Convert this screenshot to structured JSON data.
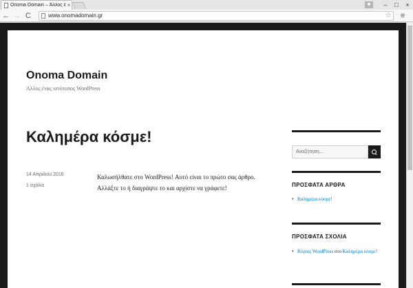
{
  "browser": {
    "tab_title": "Onoma Domain – Άλλος ένας ιστότοπος WordPress",
    "tab_close": "×",
    "url": "www.onomadomain.gr",
    "window_controls": {
      "minimize": "–",
      "maximize": "□",
      "close": "×"
    },
    "nav": {
      "back": "←",
      "forward": "→",
      "reload": "C"
    },
    "star": "☆",
    "menu": "≡"
  },
  "site": {
    "title": "Onoma Domain",
    "description": "Άλλος ένας ιστότοπος WordPress"
  },
  "post": {
    "title": "Καλημέρα κόσμε!",
    "date": "14 Απριλίου 2016",
    "comments": "1 σχόλιο",
    "line1": "Καλωσήλθατε στο WordPress! Αυτό είναι το πρώτο σας άρθρο.",
    "line2": "Αλλάξτε το ή διαγράψτε το και αρχίστε να γράφετε!"
  },
  "sidebar": {
    "search_placeholder": "Αναζήτηση...",
    "recent_posts_title": "ΠΡΟΣΦΑΤΑ ΑΡΘΡΑ",
    "recent_posts": [
      {
        "label": "Καλημέρα κόσμε!"
      }
    ],
    "recent_comments_title": "ΠΡΟΣΦΑΤΑ ΣΧΟΛΙΑ",
    "recent_comments": [
      {
        "author": "Κύριος WordPress",
        "connector": " στο ",
        "post": "Καλημέρα κόσμε!"
      }
    ]
  },
  "colors": {
    "link": "#007acc",
    "text": "#1a1a1a",
    "frame": "#1a1a1a"
  }
}
